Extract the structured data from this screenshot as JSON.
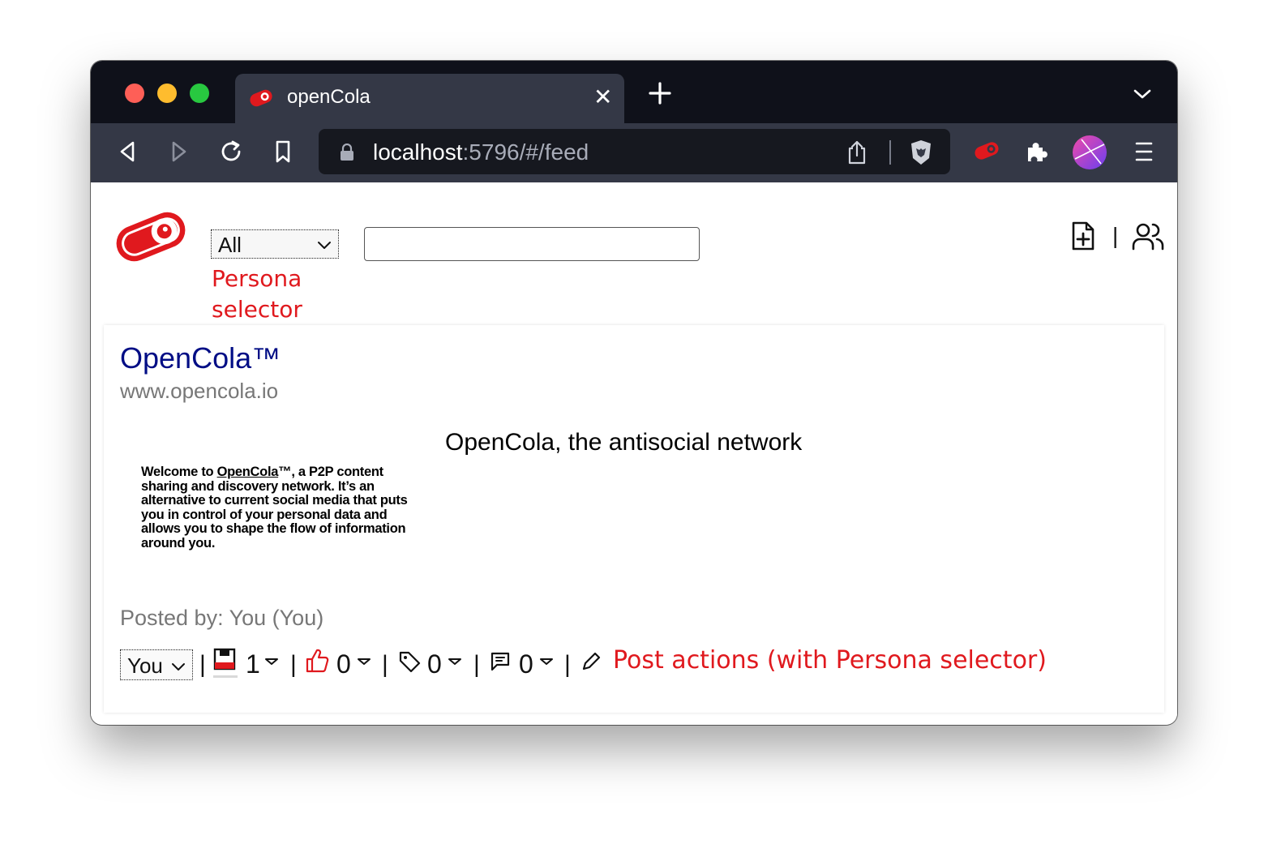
{
  "browser": {
    "tab": {
      "title": "openCola",
      "close_glyph": "✕"
    },
    "url": {
      "host": "localhost",
      "rest": ":5796/#/feed"
    },
    "colors": {
      "titlebar": "#0f111a",
      "toolbar": "#343846",
      "accent_red": "#e0191e"
    }
  },
  "header": {
    "persona_select": {
      "value": "All"
    },
    "persona_annotation_line1": "Persona",
    "persona_annotation_line2": "selector",
    "search": {
      "value": "",
      "placeholder": ""
    },
    "separator": "|"
  },
  "post": {
    "title": "OpenCola™",
    "domain": "www.opencola.io",
    "heading": "OpenCola, the antisocial network",
    "summary": {
      "before": "Welcome to ",
      "link": "OpenCola",
      "after": "™, a P2P content sharing and discovery network. It’s an alternative to current social media that puts you in control of your personal data and allows you to shape the flow of information around you."
    },
    "posted_by": "Posted by: You (You)",
    "actions": {
      "persona_value": "You",
      "separator": "|",
      "save_count": "1",
      "like_count": "0",
      "tag_count": "0",
      "comment_count": "0",
      "annotation": "Post actions (with Persona selector)"
    }
  }
}
